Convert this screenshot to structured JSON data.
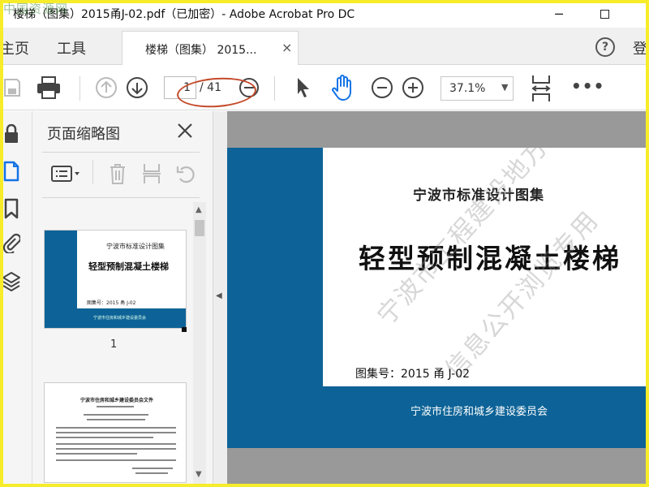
{
  "window": {
    "title": "楼梯（图集）2015甬J-02.pdf（已加密）- Adobe Acrobat Pro DC",
    "minimize_glyph": "─"
  },
  "watermark_logo": "中国资源网",
  "menu": {
    "home_label": "主页",
    "tools_label": "工具",
    "tab_label": "楼梯（图集） 2015...",
    "tab_close": "×",
    "help_glyph": "?",
    "login_label": "登"
  },
  "toolbar": {
    "page_current": "1",
    "page_total": "/ 41",
    "zoom_value": "37.1%",
    "zoom_caret": "▼",
    "more": "•••"
  },
  "thumbnails_panel": {
    "title": "页面缩略图",
    "thumb1": {
      "subtitle": "宁波市标准设计图集",
      "title": "轻型预制混凝土楼梯",
      "number": "图集号：2015 甬 J-02",
      "publisher": "宁波市住房和城乡建设委员会",
      "label": "1"
    },
    "thumb2": {
      "title": "宁波市住房和城乡建设委员会文件"
    },
    "scroll_up": "▲",
    "scroll_down": "▼"
  },
  "collapse_arrow": "◀",
  "document": {
    "subtitle": "宁波市标准设计图集",
    "title": "轻型预制混凝土楼梯",
    "number": "图集号：2015 甬 J-02",
    "publisher": "宁波市住房和城乡建设委员会",
    "watermark_line1": "宁波市工程建设地方细则",
    "watermark_line2": "信息公开浏览专用"
  },
  "colors": {
    "cover_blue": "#0d6397",
    "frame_yellow": "#f7ec2a",
    "annotation_red": "#c44a2a",
    "accent_blue": "#1473e6"
  }
}
